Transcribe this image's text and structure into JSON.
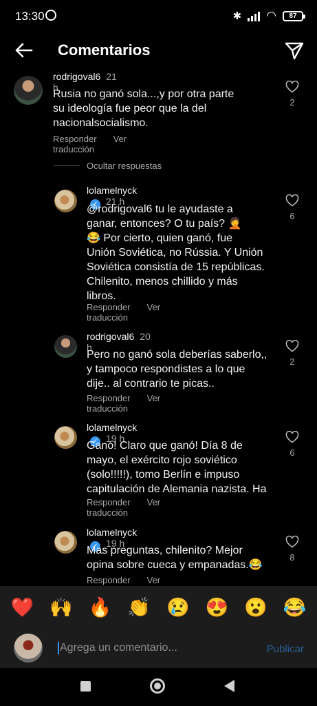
{
  "status_bar": {
    "time": "13:30",
    "battery": "87"
  },
  "header": {
    "title": "Comentarios"
  },
  "comments": [
    {
      "user": "rodrigoval6",
      "time": "21 h",
      "verified": false,
      "text": "Rusia no ganó  sola...,y por otra parte\nsu ideología  fue peor que la del\nnacionalsocialismo.",
      "likes": "2",
      "reply_label": "Responder",
      "translate_label": "Ver traducción"
    },
    {
      "user": "lolamelnyck",
      "time": "21 h",
      "verified": true,
      "text": "@rodrigoval6 tu le ayudaste a\nganar, entonces? O tu país? 🤦\n😂 Por cierto, quien ganó, fue\nUnión Soviética, no Rússia. Y Unión\nSoviética consistía de 15 repúblicas.\nChilenito, menos chillido y más\nlibros.",
      "likes": "6",
      "reply_label": "Responder",
      "translate_label": "Ver traducción"
    },
    {
      "user": "rodrigoval6",
      "time": "20 h",
      "verified": false,
      "text": "Pero no ganó  sola deberías saberlo,,\ny tampoco respondistes a lo que\ndije.. al contrario te picas..",
      "likes": "2",
      "reply_label": "Responder",
      "translate_label": "Ver traducción"
    },
    {
      "user": "lolamelnyck",
      "time": "19 h",
      "verified": true,
      "text": "Ganó! Claro que ganó! Día 8 de\nmayo, el exército rojo soviético\n(solo!!!!!), tomo Berlín e impuso\ncapitulación de Alemania nazista. Ha",
      "likes": "6",
      "reply_label": "Responder",
      "translate_label": "Ver traducción"
    },
    {
      "user": "lolamelnyck",
      "time": "19 h",
      "verified": true,
      "text": "Mas preguntas, chilenito? Mejor\nopina sobre cueca y empanadas.😂",
      "likes": "8",
      "reply_label": "Responder",
      "translate_label": "Ver traducción"
    }
  ],
  "hide_replies_label": "Ocultar respuestas",
  "emoji_bar": [
    "❤️",
    "🙌",
    "🔥",
    "👏",
    "😢",
    "😍",
    "😮",
    "😂"
  ],
  "composer": {
    "placeholder": "Agrega un comentario...",
    "publish_label": "Publicar"
  },
  "colors": {
    "background": "#000000",
    "verified": "#3897f0",
    "muted": "#a8a8a8",
    "publish": "#2a5f96"
  }
}
